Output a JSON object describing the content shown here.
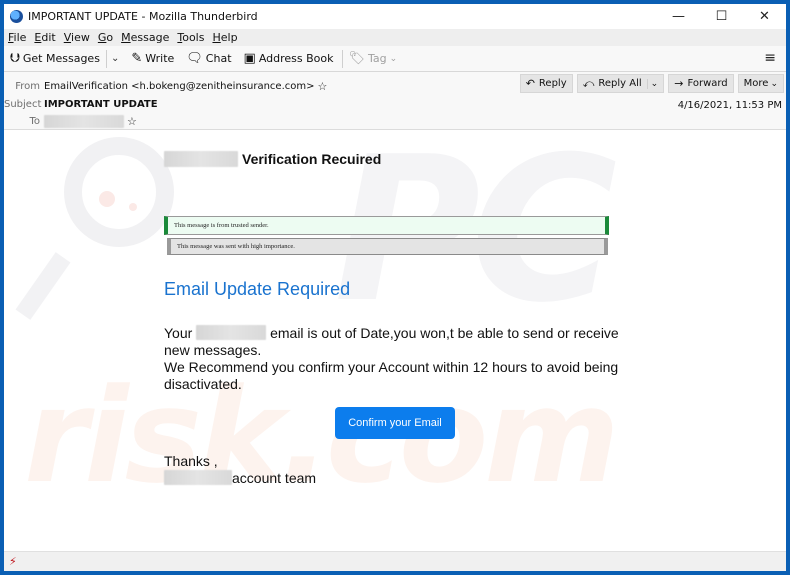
{
  "window": {
    "title": "IMPORTANT UPDATE - Mozilla Thunderbird",
    "controls": {
      "minimize": "—",
      "maximize": "☐",
      "close": "✕"
    }
  },
  "menubar": {
    "items": [
      {
        "accel": "F",
        "rest": "ile"
      },
      {
        "accel": "E",
        "rest": "dit"
      },
      {
        "accel": "V",
        "rest": "iew"
      },
      {
        "accel": "G",
        "rest": "o"
      },
      {
        "accel": "M",
        "rest": "essage"
      },
      {
        "accel": "T",
        "rest": "ools"
      },
      {
        "accel": "H",
        "rest": "elp"
      }
    ]
  },
  "toolbar": {
    "get_messages": "Get Messages",
    "write": "Write",
    "chat": "Chat",
    "address_book": "Address Book",
    "tag": "Tag",
    "icons": {
      "get_messages": "⮋",
      "write": "✎",
      "chat": "🗨",
      "address_book": "▣",
      "tag": "⌂",
      "dropdown": "⌄",
      "menu": "≡"
    }
  },
  "header": {
    "from_label": "From",
    "from_value": "EmailVerification <h.bokeng@zenitheinsurance.com>",
    "subject_label": "Subject",
    "subject_value": "IMPORTANT UPDATE",
    "to_label": "To",
    "date": "4/16/2021, 11:53 PM",
    "star": "☆",
    "actions": {
      "reply": "Reply",
      "reply_all": "Reply All",
      "forward": "Forward",
      "more": "More",
      "reply_icon": "↶",
      "reply_all_icon": "⤺",
      "forward_icon": "→",
      "dropdown_icon": "⌄"
    }
  },
  "email": {
    "heading_suffix": "Verification Recuired",
    "banner_trusted": "This message is from trusted sender.",
    "banner_importance": "This message was sent with high importance.",
    "title": "Email Update Required",
    "para_line1_start": "Your",
    "para_line1_end": "email is out of Date,you won,t be able to send or receive new messages.",
    "para_line2": "We Recommend you confirm your Account within 12 hours to avoid being disactivated.",
    "cta": "Confirm your Email",
    "thanks": "Thanks ,",
    "team_suffix": "account team",
    "colors": {
      "title": "#1a73cf",
      "cta_bg": "#0c7ded",
      "trusted_bar": "#1b8a3a"
    }
  },
  "watermark": {
    "top": "PC",
    "bottom": "risk.com"
  },
  "statusbar": {
    "icon": "offline-icon",
    "glyph": "⚡"
  }
}
